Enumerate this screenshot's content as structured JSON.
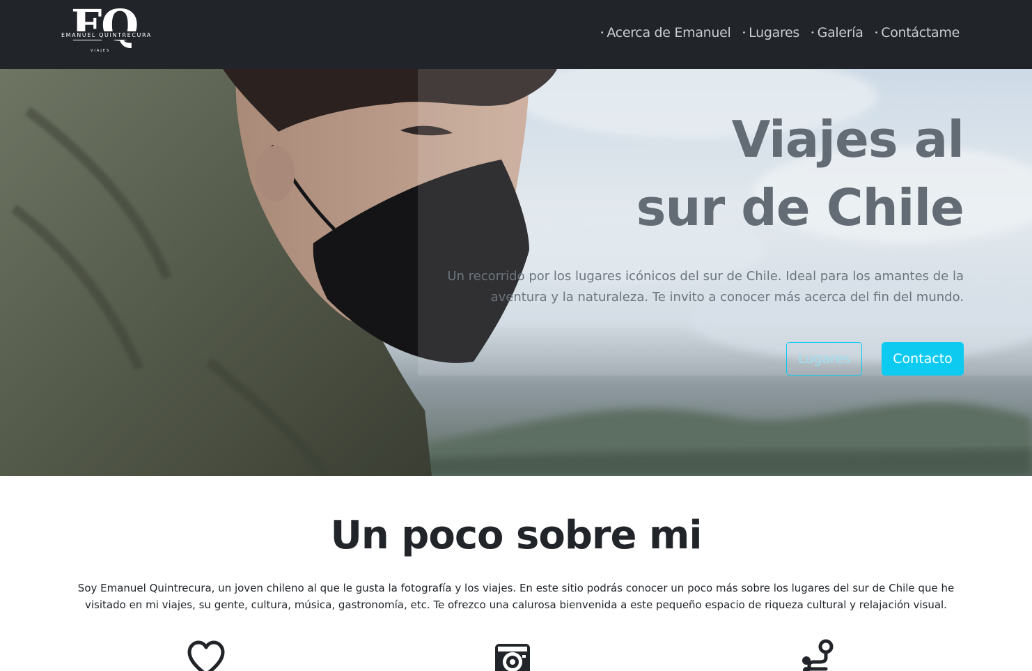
{
  "logo": {
    "letters": "EQ",
    "name": "EMANUEL QUINTRECURA",
    "subtitle": "VIAJES"
  },
  "nav": {
    "items": [
      {
        "label": "Acerca de Emanuel"
      },
      {
        "label": "Lugares"
      },
      {
        "label": "Galería"
      },
      {
        "label": "Contáctame"
      }
    ]
  },
  "hero": {
    "title_line1": "Viajes al",
    "title_line2": "sur de Chile",
    "text": "Un recorrido por los lugares icónicos del sur de Chile. Ideal para los amantes de la aventura y la naturaleza. Te invito a conocer más acerca del fin del mundo.",
    "btn_outline": "Lugares",
    "btn_solid": "Contacto"
  },
  "about": {
    "title": "Un poco sobre mi",
    "text": "Soy Emanuel Quintrecura, un joven chileno al que le gusta la fotografía y los viajes. En este sitio podrás conocer un poco más sobre los lugares del sur de Chile que he visitado en mi viajes, su gente, cultura, música, gastronomía, etc. Te ofrezco una calurosa bienvenida a este pequeño espacio de riqueza cultural y relajación visual."
  },
  "features": {
    "icons": [
      "heart-icon",
      "camera-icon",
      "route-icon"
    ]
  },
  "colors": {
    "navbar_bg": "#212429",
    "accent": "#0dcaf0",
    "hero_title": "#636b74",
    "text_dark": "#212529"
  }
}
